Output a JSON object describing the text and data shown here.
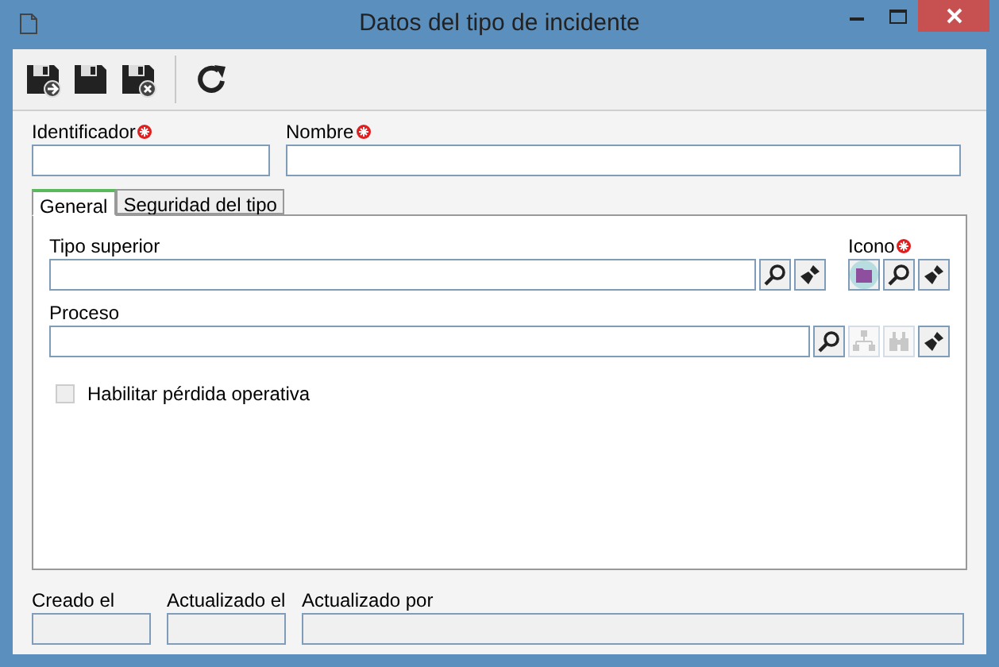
{
  "window": {
    "title": "Datos del tipo de incidente"
  },
  "toolbar": [
    {
      "kind": "save-new"
    },
    {
      "kind": "save"
    },
    {
      "kind": "save-close"
    },
    {
      "kind": "separator"
    },
    {
      "kind": "refresh"
    }
  ],
  "header_fields": [
    {
      "label": "Identificador",
      "required": true
    },
    {
      "label": "Nombre",
      "required": true
    }
  ],
  "tabs": [
    {
      "label": "General",
      "selected": true
    },
    {
      "label": "Seguridad del tipo",
      "selected": false
    }
  ],
  "tipo_superior": {
    "label": "Tipo superior",
    "required": false,
    "buttons": [
      {
        "kind": "search",
        "disabled": false
      },
      {
        "kind": "clear",
        "disabled": false
      }
    ]
  },
  "icono": {
    "label": "Icono",
    "required": true,
    "buttons": [
      {
        "kind": "folder",
        "disabled": false
      },
      {
        "kind": "search",
        "disabled": false
      },
      {
        "kind": "clear",
        "disabled": false
      }
    ]
  },
  "proceso": {
    "label": "Proceso",
    "required": false,
    "buttons": [
      {
        "kind": "search",
        "disabled": false
      },
      {
        "kind": "hierarchy",
        "disabled": true
      },
      {
        "kind": "binoculars",
        "disabled": true
      },
      {
        "kind": "clear",
        "disabled": false
      }
    ]
  },
  "checkbox": {
    "label": "Habilitar pérdida operativa",
    "checked": false,
    "disabled": true
  },
  "footer_fields": [
    {
      "label": "Creado el",
      "disabled": true
    },
    {
      "label": "Actualizado el",
      "disabled": true
    },
    {
      "label": "Actualizado por",
      "disabled": true
    }
  ]
}
